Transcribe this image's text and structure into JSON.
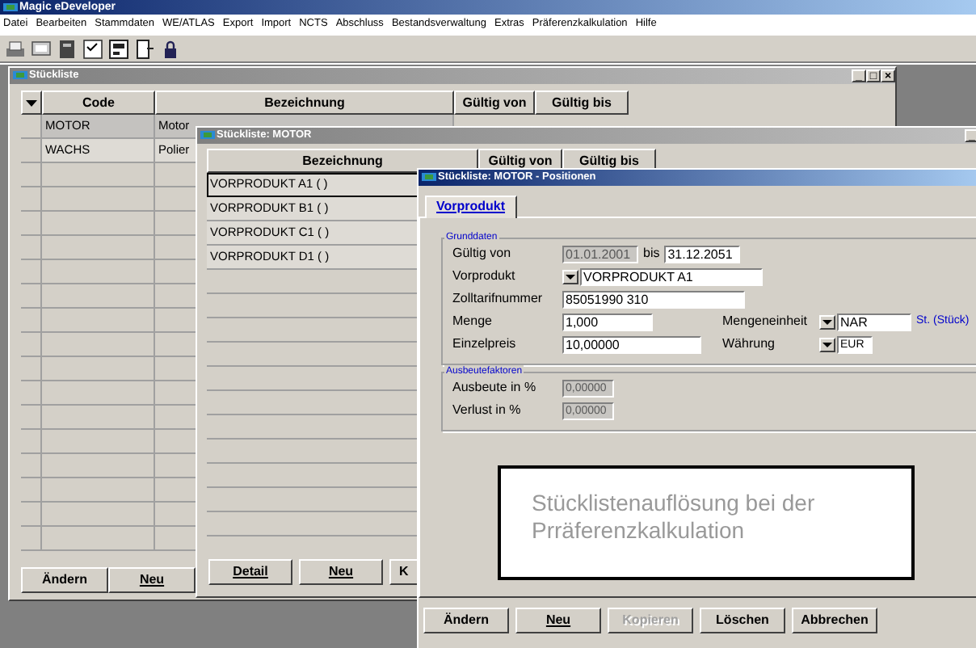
{
  "app": {
    "title": "Magic eDeveloper",
    "menu": [
      "Datei",
      "Bearbeiten",
      "Stammdaten",
      "WE/ATLAS",
      "Export",
      "Import",
      "NCTS",
      "Abschluss",
      "Bestandsverwaltung",
      "Extras",
      "Präferenzkalkulation",
      "Hilfe"
    ]
  },
  "list_window": {
    "title": "Stückliste",
    "controls": [
      "_",
      "□",
      "×"
    ],
    "columns": [
      "Code",
      "Bezeichnung",
      "Gültig von",
      "Gültig bis"
    ],
    "rows": [
      {
        "code": "MOTOR",
        "bezeichnung": "Motor",
        "selected": true
      },
      {
        "code": "WACHS",
        "bezeichnung": "Polier",
        "selected": false
      }
    ],
    "buttons": [
      {
        "label": "Ändern",
        "underlined": false
      },
      {
        "label": "Neu",
        "underlined": true
      }
    ]
  },
  "detail_window": {
    "title": "Stückliste: MOTOR",
    "controls": [
      "_"
    ],
    "columns": [
      "Bezeichnung",
      "Gültig von",
      "Gültig bis"
    ],
    "rows": [
      {
        "bezeichnung": "VORPRODUKT A1 ( )",
        "selected": true
      },
      {
        "bezeichnung": "VORPRODUKT B1 ( )",
        "selected": false
      },
      {
        "bezeichnung": "VORPRODUKT C1 ( )",
        "selected": false
      },
      {
        "bezeichnung": "VORPRODUKT D1 ( )",
        "selected": false
      }
    ],
    "buttons": [
      {
        "label": "Detail",
        "underlined": true
      },
      {
        "label": "Neu",
        "underlined": true
      },
      {
        "label": "K",
        "underlined": false
      }
    ]
  },
  "positions_window": {
    "title": "Stückliste: MOTOR - Positionen",
    "tabs": [
      {
        "label": "Vorprodukt",
        "selected": true
      }
    ],
    "groups": [
      {
        "legend": "Grunddaten",
        "rows": [
          {
            "label": "Gültig von",
            "main": [
              {
                "kind": "field",
                "value": "01.01.2001",
                "disabled": true,
                "dropdown": false
              },
              {
                "kind": "text",
                "text": "bis"
              },
              {
                "kind": "field",
                "value": "31.12.2051",
                "disabled": false,
                "dropdown": false
              }
            ]
          },
          {
            "label": "Vorprodukt",
            "main": [
              {
                "kind": "field",
                "value": "VORPRODUKT A1",
                "disabled": false,
                "dropdown": true
              }
            ]
          },
          {
            "label": "Zolltarifnummer",
            "main": [
              {
                "kind": "field",
                "value": "85051990 310",
                "disabled": false,
                "dropdown": false
              }
            ]
          },
          {
            "label": "Menge",
            "main": [
              {
                "kind": "field",
                "value": "1,000",
                "disabled": false,
                "dropdown": false
              }
            ],
            "second": {
              "label": "Mengeneinheit",
              "field": {
                "kind": "field",
                "value": "NAR",
                "disabled": false,
                "dropdown": true
              },
              "note": "St. (Stück)"
            }
          },
          {
            "label": "Einzelpreis",
            "main": [
              {
                "kind": "field",
                "value": "10,00000",
                "disabled": false,
                "dropdown": false
              }
            ],
            "second": {
              "label": "Währung",
              "field": {
                "kind": "field",
                "value": "EUR",
                "disabled": false,
                "dropdown": true
              }
            }
          }
        ]
      },
      {
        "legend": "Ausbeutefaktoren",
        "rows": [
          {
            "label": "Ausbeute in %",
            "main": [
              {
                "kind": "field",
                "value": "0,00000",
                "disabled": true,
                "dropdown": false
              }
            ]
          },
          {
            "label": "Verlust in %",
            "main": [
              {
                "kind": "field",
                "value": "0,00000",
                "disabled": true,
                "dropdown": false
              }
            ]
          }
        ]
      }
    ],
    "buttons": [
      {
        "label": "Ändern",
        "underlined": false,
        "disabled": false
      },
      {
        "label": "Neu",
        "underlined": true,
        "disabled": false
      },
      {
        "label": "Kopieren",
        "underlined": false,
        "disabled": true
      },
      {
        "label": "Löschen",
        "underlined": false,
        "disabled": false
      },
      {
        "label": "Abbrechen",
        "underlined": false,
        "disabled": false
      }
    ]
  },
  "callout": {
    "text": "Stücklistenauflösung bei der Prräferenzkalkulation"
  }
}
